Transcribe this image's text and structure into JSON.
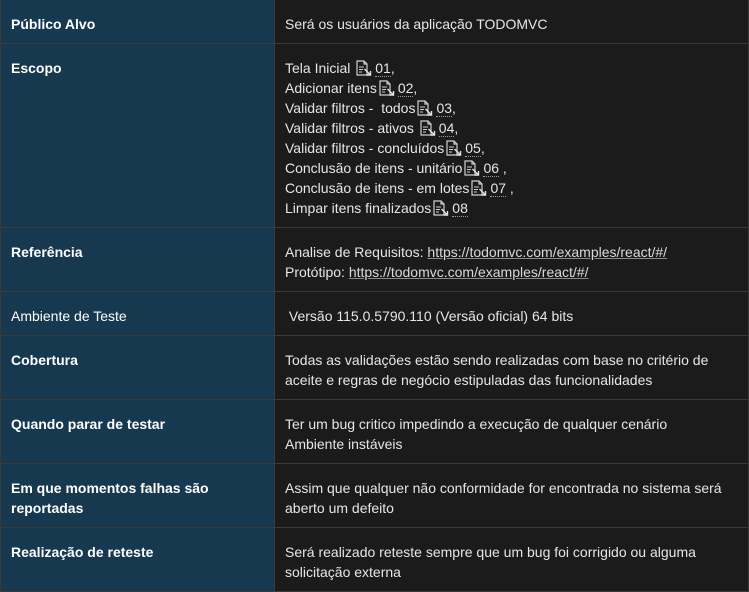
{
  "rows": {
    "publico_alvo": {
      "label": "Público Alvo",
      "value": "Será os usuários da aplicação TODOMVC"
    },
    "escopo": {
      "label": "Escopo",
      "items": [
        {
          "text": "Tela Inicial ",
          "ref": "01",
          "suffix": ","
        },
        {
          "text": "Adicionar itens",
          "ref": "02",
          "suffix": ","
        },
        {
          "text": "Validar filtros -  todos",
          "ref": "03",
          "suffix": ","
        },
        {
          "text": "Validar filtros - ativos ",
          "ref": "04",
          "suffix": ","
        },
        {
          "text": "Validar filtros - concluídos",
          "ref": "05",
          "suffix": ","
        },
        {
          "text": "Conclusão de itens - unitário",
          "ref": "06",
          "suffix": " ,"
        },
        {
          "text": "Conclusão de itens - em lotes",
          "ref": "07",
          "suffix": " ,"
        },
        {
          "text": "Limpar itens finalizados",
          "ref": "08",
          "suffix": ""
        }
      ],
      "icon": "document-link-icon"
    },
    "referencia": {
      "label": "Referência",
      "requisitos_prefix": "Analise de Requisitos: ",
      "requisitos_url": "https://todomvc.com/examples/react/#/",
      "prototipo_prefix": "Protótipo: ",
      "prototipo_url": "https://todomvc.com/examples/react/#/"
    },
    "ambiente": {
      "label": "Ambiente de Teste",
      "value": " Versão 115.0.5790.110 (Versão oficial) 64 bits"
    },
    "cobertura": {
      "label": "Cobertura",
      "line1": "Todas as validações estão sendo realizadas com base no critério de",
      "line2": "aceite e regras de negócio estipuladas das funcionalidades"
    },
    "quando_parar": {
      "label": "Quando parar de testar",
      "line1": "Ter um bug critico impedindo a execução de qualquer cenário",
      "line2": "Ambiente instáveis"
    },
    "falhas": {
      "label_line1": "Em que momentos falhas são",
      "label_line2": "reportadas",
      "line1": "Assim que qualquer não conformidade for encontrada no sistema será",
      "line2": "aberto um defeito"
    },
    "reteste": {
      "label": "Realização de reteste",
      "line1": "Será realizado reteste sempre que um bug foi corrigido ou alguma",
      "line2": "solicitação externa"
    }
  },
  "colors": {
    "label_bg": "#17394f",
    "value_bg": "#1b1b1b",
    "border": "#3a3a3a"
  }
}
